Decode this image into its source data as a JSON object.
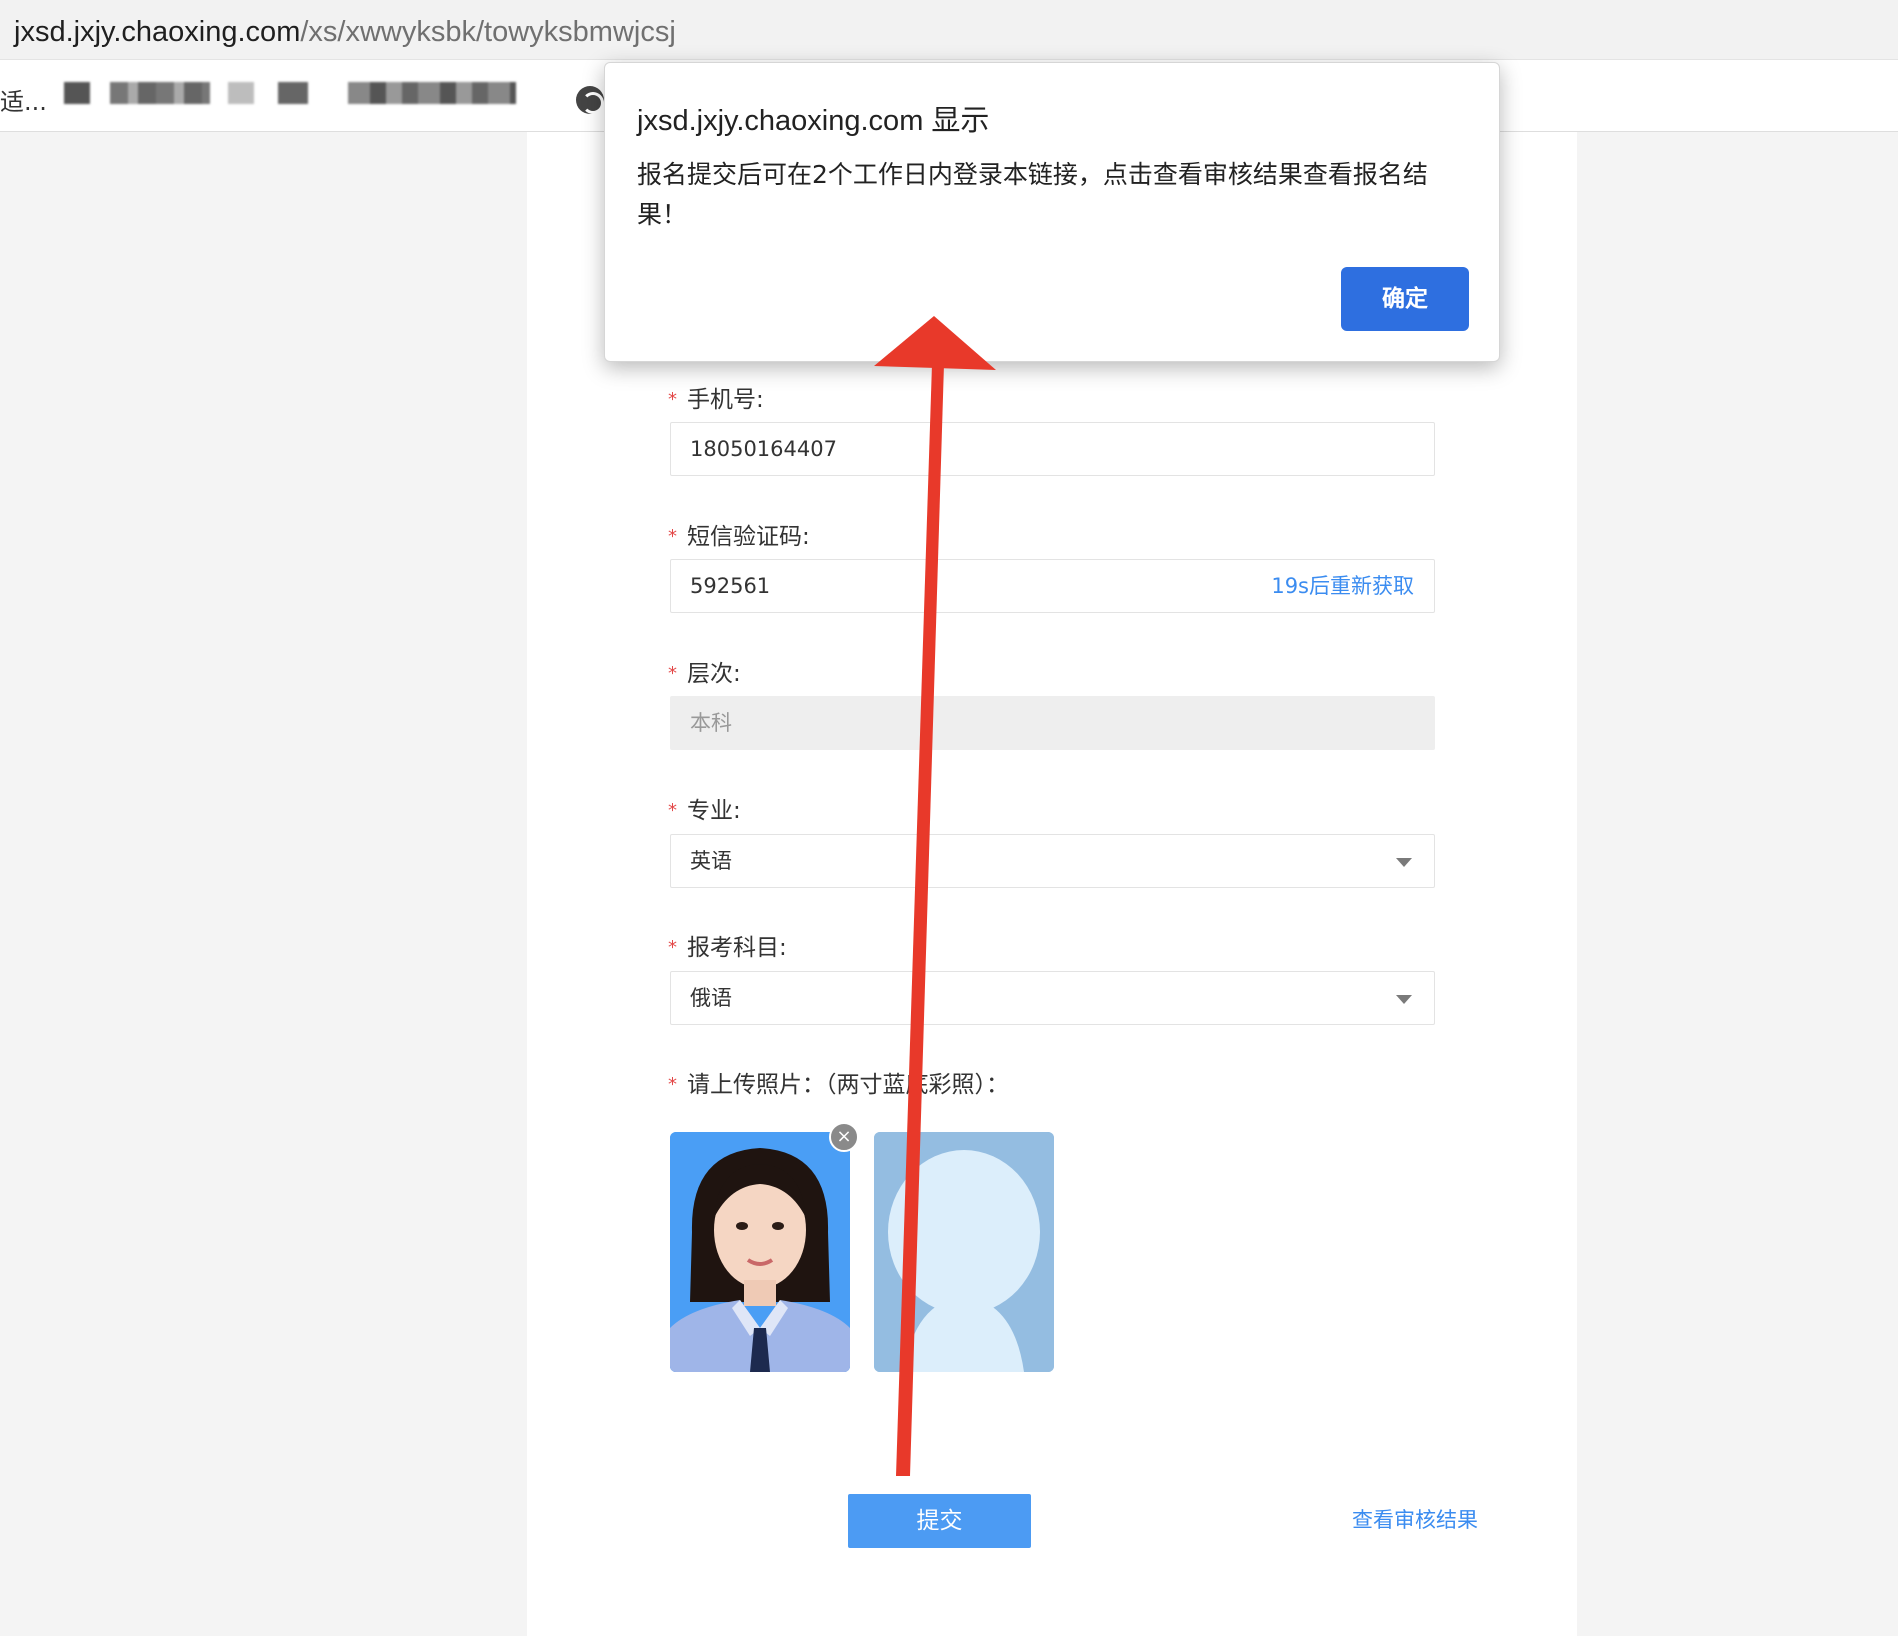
{
  "browser": {
    "url_host": "jxsd.jxjy.chaoxing.com",
    "url_path": "/xs/xwwyksbk/towyksbmwjcsj",
    "bookmark_truncated": "适..."
  },
  "form": {
    "phone": {
      "label": "手机号:",
      "value": "18050164407"
    },
    "sms_code": {
      "label": "短信验证码:",
      "value": "592561",
      "resend": "19s后重新获取"
    },
    "level": {
      "label": "层次:",
      "value": "本科"
    },
    "major": {
      "label": "专业:",
      "value": "英语"
    },
    "subject": {
      "label": "报考科目:",
      "value": "俄语"
    },
    "photo": {
      "label": "请上传照片：（两寸蓝底彩照）：",
      "remove_glyph": "×"
    },
    "required_mark": "*",
    "submit_label": "提交",
    "check_result_label": "查看审核结果"
  },
  "dialog": {
    "title": "jxsd.jxjy.chaoxing.com 显示",
    "message": "报名提交后可在2个工作日内登录本链接，点击查看审核结果查看报名结果！",
    "ok_label": "确定"
  },
  "colors": {
    "accent": "#3b8cf0",
    "submit": "#4c9bf3",
    "dialog_ok": "#2e6fe0",
    "required": "#e34848",
    "arrow": "#e8392a",
    "photo_bg": "#4a9ef5",
    "placeholder_bg": "#94bde1"
  },
  "icons": {
    "globe": "globe-icon",
    "dropdown": "chevron-down-icon",
    "remove": "close-icon"
  }
}
